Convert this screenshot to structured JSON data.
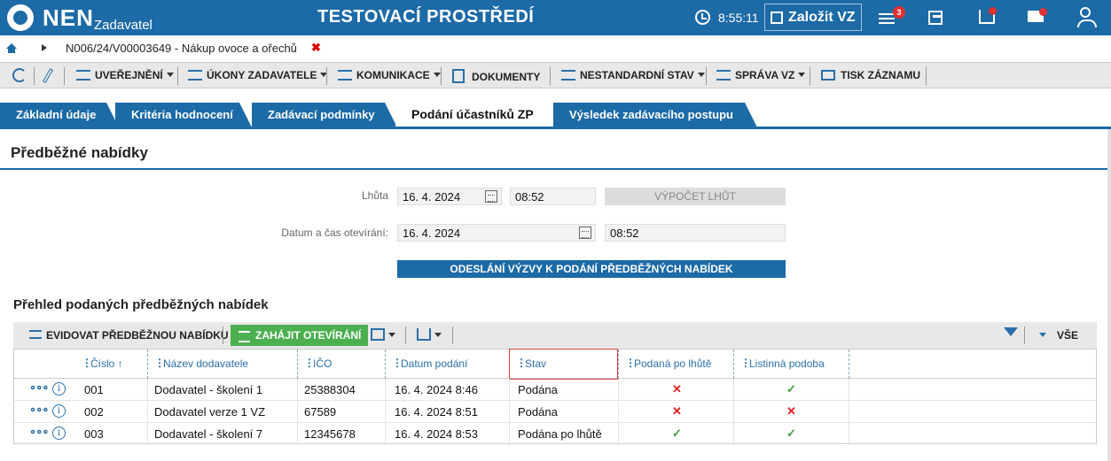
{
  "app": {
    "logo_text": "NEN",
    "logo_sub": "Zadavatel",
    "environment": "TESTOVACÍ PROSTŘEDÍ",
    "time": "8:55:11",
    "new_contract": "Založit VZ",
    "menu_badge": "3"
  },
  "breadcrumb": {
    "text": "N006/24/V00003649 - Nákup ovoce a ořechů",
    "close": "✖"
  },
  "actions": [
    "UVEŘEJNĚNÍ",
    "ÚKONY ZADAVATELE",
    "KOMUNIKACE",
    "DOKUMENTY",
    "NESTANDARDNÍ STAV",
    "SPRÁVA VZ",
    "TISK ZÁZNAMU"
  ],
  "tabs": [
    "Základní údaje",
    "Kritéria hodnocení",
    "Zadávací podmínky",
    "Podání účastníků ZP",
    "Výsledek zadávacího postupu"
  ],
  "section": {
    "title": "Předběžné nabídky",
    "deadline_label": "Lhůta",
    "deadline_date": "16. 4. 2024",
    "deadline_time": "08:52",
    "calc_button": "VÝPOČET LHŮT",
    "opening_label": "Datum a čas otevírání:",
    "opening_date": "16. 4. 2024",
    "opening_time": "08:52",
    "send_button": "ODESLÁNÍ VÝZVY K PODÁNÍ PŘEDBĚŽNÝCH NABÍDEK"
  },
  "overview": {
    "title": "Přehled podaných předběžných nabídek",
    "register_button": "EVIDOVAT PŘEDBĚŽNOU NABÍDKU",
    "start_button": "ZAHÁJIT OTEVÍRÁNÍ",
    "filter_all": "VŠE"
  },
  "table": {
    "columns": [
      "Číslo ↑",
      "Název dodavatele",
      "IČO",
      "Datum podání",
      "Stav",
      "Podaná po lhůtě",
      "Listinná podoba"
    ],
    "rows": [
      {
        "num": "001",
        "name": "Dodavatel - školení 1",
        "ico": "25388304",
        "date": "16. 4. 2024 8:46",
        "state": "Podána",
        "late": "✕",
        "paper": "✓"
      },
      {
        "num": "002",
        "name": "Dodavatel verze 1 VZ",
        "ico": "67589",
        "date": "16. 4. 2024 8:51",
        "state": "Podána",
        "late": "✕",
        "paper": "✕"
      },
      {
        "num": "003",
        "name": "Dodavatel - školení 7",
        "ico": "12345678",
        "date": "16. 4. 2024 8:53",
        "state": "Podána po lhůtě",
        "late": "✓",
        "paper": "✓"
      }
    ],
    "row_more": "∘∘∘",
    "row_info": "i"
  }
}
